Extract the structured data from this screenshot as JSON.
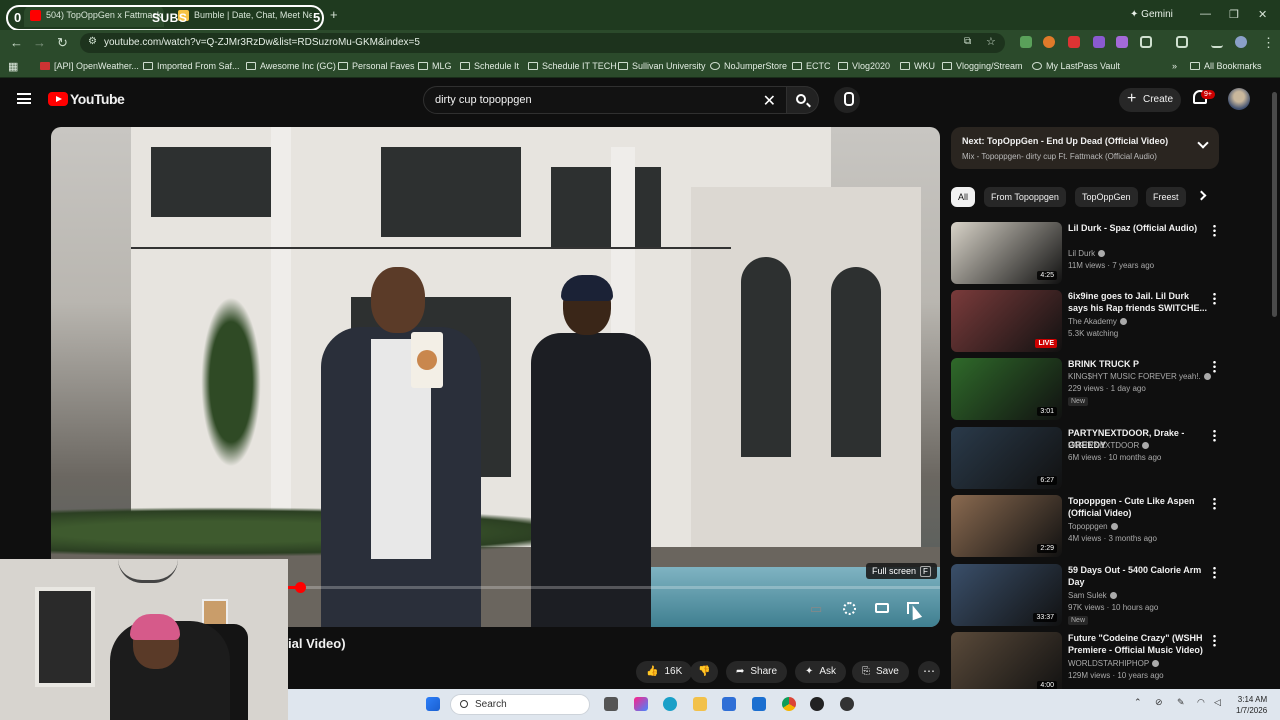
{
  "browser": {
    "tabs": [
      {
        "label": "504) TopOppGen x Fattmack",
        "active": true
      },
      {
        "label": "Bumble | Date, Chat, Meet New",
        "active": false
      }
    ],
    "overlay": {
      "left_count": "0",
      "label": "SUBS",
      "right_count": "5"
    },
    "gemini_label": "Gemini",
    "url": "youtube.com/watch?v=Q-ZJMr3RzDw&list=RDSuzroMu-GKM&index=5",
    "bookmarks": [
      "[API] OpenWeather...",
      "Imported From Saf...",
      "Awesome Inc (GC)",
      "Personal Faves",
      "MLG",
      "Schedule It",
      "Schedule IT TECH",
      "Sullivan University",
      "NoJumperStore",
      "ECTC",
      "Vlog2020",
      "WKU",
      "Vlogging/Stream",
      "My LastPass Vault"
    ],
    "all_bookmarks": "All Bookmarks"
  },
  "youtube": {
    "logo_text": "YouTube",
    "search_query": "dirty cup topoppgen",
    "create_label": "Create",
    "notif_badge": "9+"
  },
  "player": {
    "progress": 0.28,
    "fullscreen_tip": "Full screen",
    "fullscreen_key": "F",
    "title_fragment": "ial Video)"
  },
  "actions": {
    "likes": "16K",
    "share": "Share",
    "ask": "Ask",
    "save": "Save"
  },
  "up_next": {
    "title": "Next: TopOppGen - End Up Dead (Official Video)",
    "subtitle": "Mix - Topoppgen- dirty cup Ft. Fattmack (Official Audio)"
  },
  "chips": [
    "All",
    "From Topoppgen",
    "TopOppGen",
    "Freest"
  ],
  "recommendations": [
    {
      "title": "Lil Durk - Spaz (Official Audio)",
      "channel": "Lil Durk",
      "meta": "11M views · 7 years ago",
      "duration": "4:25",
      "new": "",
      "thumb": "#d8d3c8"
    },
    {
      "title": "6ix9ine goes to Jail. Lil Durk says his Rap friends SWITCHE...",
      "channel": "The Akademy",
      "meta": "5.3K watching",
      "duration": "LIVE",
      "new": "",
      "thumb": "#7a3b3b"
    },
    {
      "title": "BRINK TRUCK P",
      "channel": "KING$HYT MUSIC FOREVER yeah!.",
      "meta": "229 views · 1 day ago",
      "duration": "3:01",
      "new": "New",
      "thumb": "#2f6a2a"
    },
    {
      "title": "PARTYNEXTDOOR, Drake - GREEDY",
      "channel": "PARTYNEXTDOOR",
      "meta": "6M views · 10 months ago",
      "duration": "6:27",
      "new": "",
      "thumb": "#2a3a4a"
    },
    {
      "title": "Topoppgen - Cute Like Aspen (Official Video)",
      "channel": "Topoppgen",
      "meta": "4M views · 3 months ago",
      "duration": "2:29",
      "new": "",
      "thumb": "#8a6a50"
    },
    {
      "title": "59 Days Out - 5400 Calorie Arm Day",
      "channel": "Sam Sulek",
      "meta": "97K views · 10 hours ago",
      "duration": "33:37",
      "new": "New",
      "thumb": "#3a4f6a"
    },
    {
      "title": "Future \"Codeine Crazy\" (WSHH Premiere - Official Music Video)",
      "channel": "WORLDSTARHIPHOP",
      "meta": "129M views · 10 years ago",
      "duration": "4:00",
      "new": "",
      "thumb": "#5a4a3a"
    }
  ],
  "taskbar": {
    "search_label": "Search",
    "time": "3:14 AM",
    "date": "1/7/2026"
  },
  "colors": {
    "accent": "#ff0000",
    "chrome_green": "#2b4a2b",
    "bg": "#0f0f0f"
  }
}
